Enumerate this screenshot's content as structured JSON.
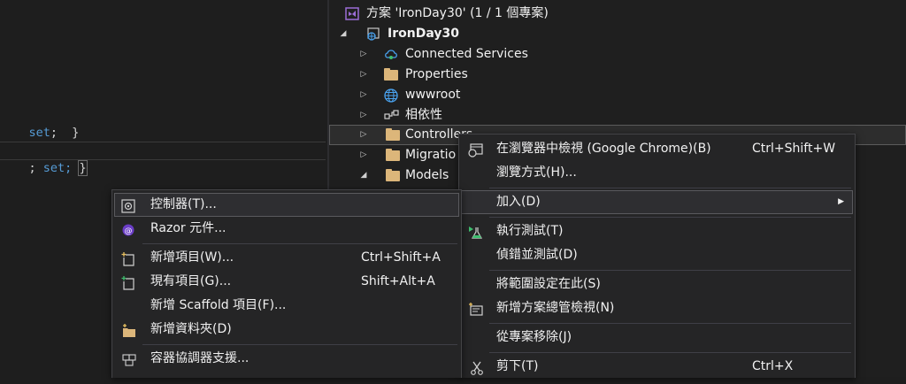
{
  "editor": {
    "line1": "set; }",
    "line2_pre": "; ",
    "line2_kw": "set;",
    "line2_brace": "}"
  },
  "explorer": {
    "solution": "方案 'IronDay30' (1 / 1 個專案)",
    "project": "IronDay30",
    "items": [
      {
        "label": "Connected Services"
      },
      {
        "label": "Properties"
      },
      {
        "label": "wwwroot"
      },
      {
        "label": "相依性"
      },
      {
        "label": "Controllers"
      },
      {
        "label": "Migratio"
      },
      {
        "label": "Models"
      }
    ]
  },
  "context_menu": {
    "view_in_browser": "在瀏覽器中檢視 (Google Chrome)(B)",
    "view_in_browser_sc": "Ctrl+Shift+W",
    "browse_with": "瀏覽方式(H)...",
    "add": "加入(D)",
    "run_tests": "執行測試(T)",
    "debug_tests": "偵錯並測試(D)",
    "scope_to_this": "將範圍設定在此(S)",
    "new_solution_view": "新增方案總管檢視(N)",
    "exclude": "從專案移除(J)",
    "cut": "剪下(T)",
    "cut_sc": "Ctrl+X"
  },
  "add_menu": {
    "controller": "控制器(T)...",
    "razor_component": "Razor 元件...",
    "new_item": "新增項目(W)...",
    "new_item_sc": "Ctrl+Shift+A",
    "existing_item": "現有項目(G)...",
    "existing_item_sc": "Shift+Alt+A",
    "new_scaffold": "新增 Scaffold 項目(F)...",
    "new_folder": "新增資料夾(D)",
    "container_support": "容器協調器支援..."
  },
  "colors": {
    "vs_purple": "#9b6dd6",
    "folder": "#dcb67a",
    "keyword": "#569cd6"
  }
}
